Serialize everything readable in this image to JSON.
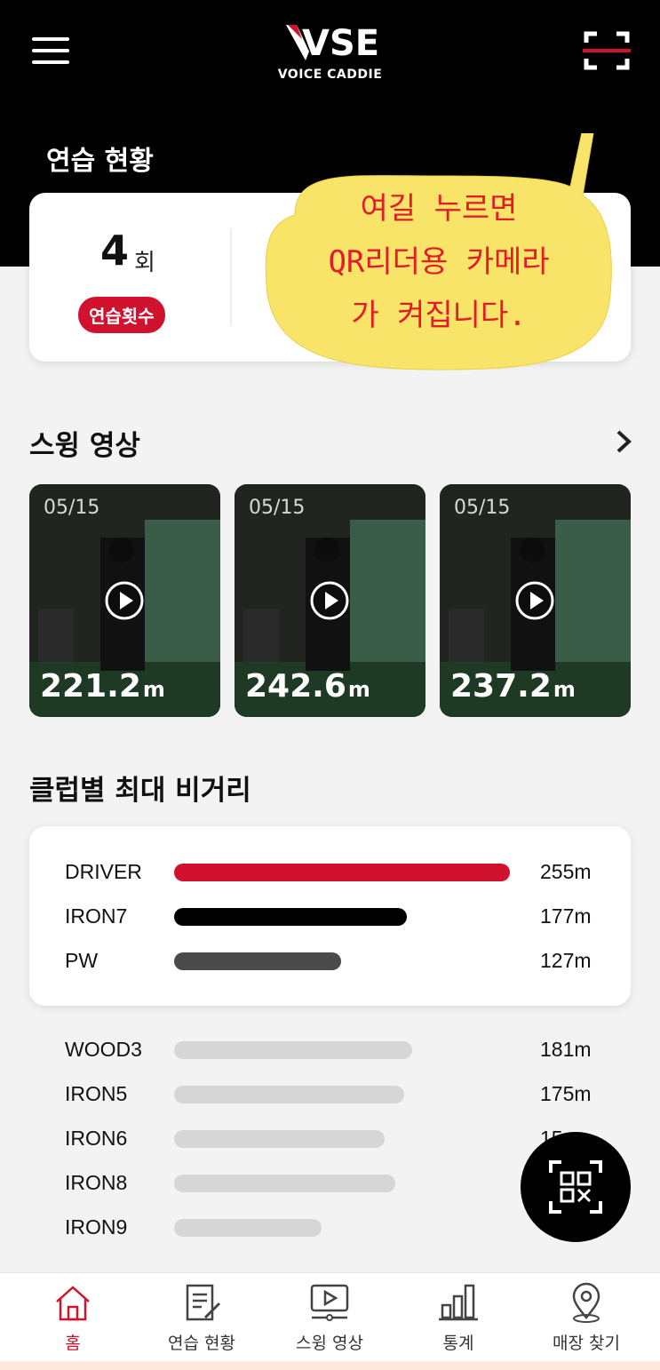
{
  "header": {
    "logo_text": "VOICE CADDIE",
    "logo_mark": "VSE",
    "icons": {
      "menu": "hamburger-menu-icon",
      "scan": "qr-scan-icon"
    }
  },
  "practice": {
    "title": "연습 현황",
    "count_value": "4",
    "count_unit": "회",
    "count_label": "연습횟수"
  },
  "annotation": {
    "lines": [
      "여길 누르면",
      "QR리더용 카메라",
      "가 켜집니다."
    ],
    "color": "#e11d2a",
    "bubble_color": "#f9e46a"
  },
  "swing": {
    "title": "스윙 영상",
    "videos": [
      {
        "date": "05/15",
        "distance": "221.2",
        "unit": "m"
      },
      {
        "date": "05/15",
        "distance": "242.6",
        "unit": "m"
      },
      {
        "date": "05/15",
        "distance": "237.2",
        "unit": "m"
      }
    ]
  },
  "clubs": {
    "title": "클럽별 최대 비거리",
    "top": [
      {
        "name": "DRIVER",
        "distance": "255",
        "unit": "m",
        "value": 255,
        "color": "#d0122e"
      },
      {
        "name": "IRON7",
        "distance": "177",
        "unit": "m",
        "value": 177,
        "color": "#000000"
      },
      {
        "name": "PW",
        "distance": "127",
        "unit": "m",
        "value": 127,
        "color": "#4a4a4a"
      }
    ],
    "others": [
      {
        "name": "WOOD3",
        "distance": "181",
        "unit": "m",
        "value": 181
      },
      {
        "name": "IRON5",
        "distance": "175",
        "unit": "m",
        "value": 175
      },
      {
        "name": "IRON6",
        "distance": "15",
        "unit": "",
        "value": 160
      },
      {
        "name": "IRON8",
        "distance": "",
        "unit": "",
        "value": 168
      },
      {
        "name": "IRON9",
        "distance": "",
        "unit": "",
        "value": 112
      }
    ],
    "max_value": 255
  },
  "nav": {
    "items": [
      {
        "label": "홈",
        "icon": "home-icon",
        "active": true
      },
      {
        "label": "연습 현황",
        "icon": "practice-report-icon",
        "active": false
      },
      {
        "label": "스윙 영상",
        "icon": "video-play-icon",
        "active": false
      },
      {
        "label": "통계",
        "icon": "bar-chart-icon",
        "active": false
      },
      {
        "label": "매장 찾기",
        "icon": "map-pin-icon",
        "active": false
      }
    ]
  },
  "colors": {
    "accent": "#d0122e",
    "header_bg": "#000000",
    "page_bg": "#f3f3f3"
  }
}
